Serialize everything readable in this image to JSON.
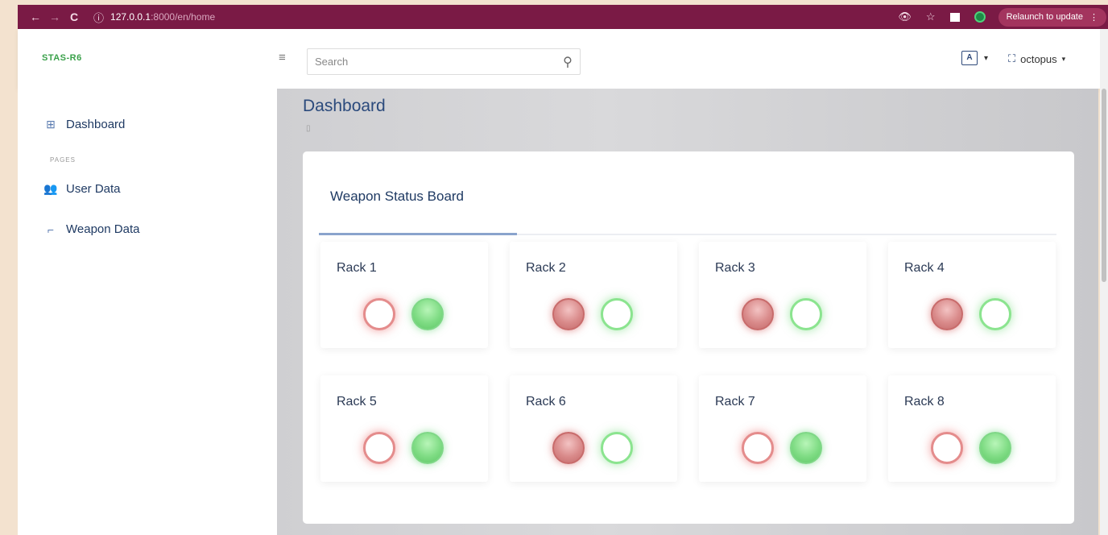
{
  "browser": {
    "back_icon": "←",
    "forward_icon": "→",
    "reload_icon": "C",
    "info_icon": "ⓘ",
    "url_host": "127.0.0.1",
    "url_path": ":8000/en/home",
    "star_icon": "☆",
    "eye_icon": "👁",
    "relaunch_label": "Relaunch to update",
    "menu_icon": "⋮"
  },
  "header": {
    "brand": "STAS-R6",
    "menu_icon": "≡",
    "search_placeholder": "Search",
    "search_icon": "⚲",
    "lang_icon": "A",
    "lang_caret": "▾",
    "user_icon": "⛶",
    "username": "octopus",
    "user_caret": "▾"
  },
  "sidebar": {
    "dashboard": {
      "icon": "⊞",
      "label": "Dashboard"
    },
    "section": "PAGES",
    "items": [
      {
        "icon": "👥",
        "label": "User Data"
      },
      {
        "icon": "⌐",
        "label": "Weapon Data"
      }
    ]
  },
  "main": {
    "title": "Dashboard",
    "subtitle_icon": "▯",
    "board_title": "Weapon Status Board",
    "racks": [
      {
        "name": "Rack 1",
        "red_on": false,
        "green_on": true
      },
      {
        "name": "Rack 2",
        "red_on": true,
        "green_on": false
      },
      {
        "name": "Rack 3",
        "red_on": true,
        "green_on": false
      },
      {
        "name": "Rack 4",
        "red_on": true,
        "green_on": false
      },
      {
        "name": "Rack 5",
        "red_on": false,
        "green_on": true
      },
      {
        "name": "Rack 6",
        "red_on": true,
        "green_on": false
      },
      {
        "name": "Rack 7",
        "red_on": false,
        "green_on": true
      },
      {
        "name": "Rack 8",
        "red_on": false,
        "green_on": true
      }
    ]
  },
  "colors": {
    "chrome": "#7a1a45",
    "brand": "#3aa14a",
    "accent": "#2b4a7c"
  }
}
